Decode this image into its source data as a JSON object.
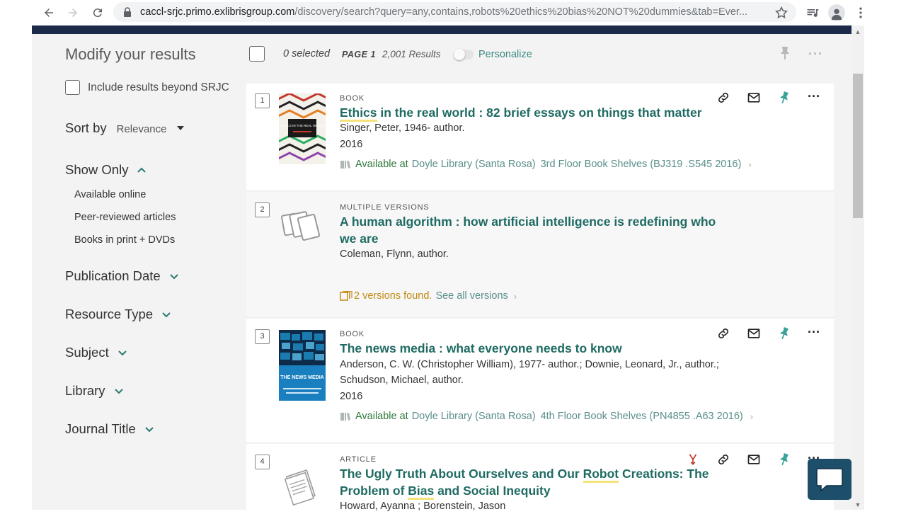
{
  "browser": {
    "url_host": "caccl-srjc.primo.exlibrisgroup.com",
    "url_path": "/discovery/search?query=any,contains,robots%20ethics%20bias%20NOT%20dummies&tab=Ever..."
  },
  "sidebar": {
    "title": "Modify your results",
    "include_label": "Include results beyond SRJC",
    "sort_label": "Sort by",
    "sort_value": "Relevance",
    "show_only_label": "Show Only",
    "show_only_items": [
      "Available online",
      "Peer-reviewed articles",
      "Books in print + DVDs"
    ],
    "facets": [
      "Publication Date",
      "Resource Type",
      "Subject",
      "Library",
      "Journal Title"
    ]
  },
  "results_header": {
    "selected": "0 selected",
    "page": "PAGE 1",
    "count": "2,001 Results",
    "personalize": "Personalize"
  },
  "results": [
    {
      "rank": "1",
      "type": "BOOK",
      "title_hl": "Ethics",
      "title_rest": " in the real world : 82 brief essays on things that matter",
      "author": "Singer, Peter, 1946- author.",
      "year": "2016",
      "avail_at": "Available at",
      "library": "Doyle Library (Santa Rosa)",
      "shelf": "3rd Floor Book Shelves (BJ319 .S545 2016)"
    },
    {
      "rank": "2",
      "type": "MULTIPLE VERSIONS",
      "title": "A human algorithm : how artificial intelligence is redefining who we are",
      "author": "Coleman, Flynn, author.",
      "versions_found": "2 versions found.",
      "see_all": "See all versions"
    },
    {
      "rank": "3",
      "type": "BOOK",
      "title": "The news media : what everyone needs to know",
      "author_line1": "Anderson, C. W. (Christopher William), 1977- author.; Downie, Leonard, Jr., author.;",
      "author_line2": "Schudson, Michael, author.",
      "year": "2016",
      "avail_at": "Available at",
      "library": "Doyle Library (Santa Rosa)",
      "shelf": "4th Floor Book Shelves (PN4855 .A63 2016)"
    },
    {
      "rank": "4",
      "type": "ARTICLE",
      "title_a": "The Ugly Truth About Ourselves and Our ",
      "title_hl1": "Robot",
      "title_b": " Creations: The",
      "title_c": "Problem of ",
      "title_hl2": "Bias",
      "title_d": " and Social Inequity",
      "author": "Howard, Ayanna ; Borenstein, Jason"
    }
  ],
  "book1_cover_title": "ETHICS IN THE REAL WORLD",
  "book3_cover_title": "THE NEWS MEDIA",
  "colors": {
    "title_teal": "#1f6b63",
    "available_green": "#2f7a3a",
    "versions_gold": "#c08a12",
    "pin_teal": "#3aa39a",
    "header_navy": "#1b2a48",
    "chat_blue": "#1d4f6b"
  },
  "icons": [
    "back-icon",
    "forward-icon",
    "reload-icon",
    "lock-icon",
    "star-icon",
    "media-icon",
    "account-icon",
    "menu-icon",
    "link-icon",
    "email-icon",
    "pin-icon",
    "more-icon",
    "chat-icon"
  ]
}
